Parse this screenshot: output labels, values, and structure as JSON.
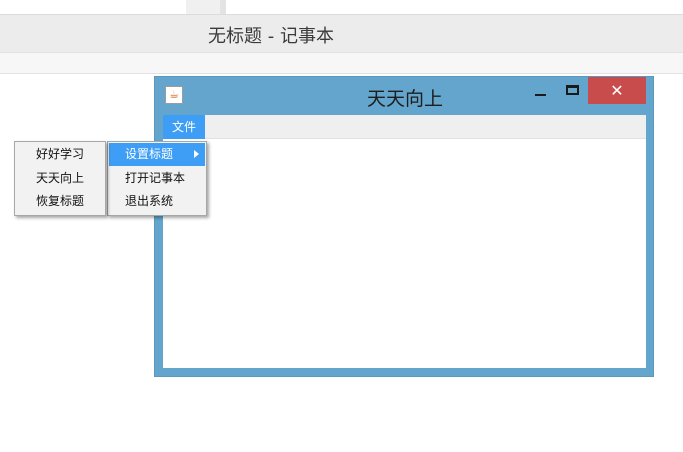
{
  "notepad": {
    "title": "无标题 - 记事本"
  },
  "frame": {
    "title": "天天向上",
    "close_glyph": "✕",
    "app_icon_glyph": "☕",
    "menu_file": "文件"
  },
  "file_menu": {
    "items": [
      {
        "label": "设置标题"
      },
      {
        "label": "打开记事本"
      },
      {
        "label": "退出系统"
      }
    ]
  },
  "title_submenu": {
    "items": [
      {
        "label": "好好学习"
      },
      {
        "label": "天天向上"
      },
      {
        "label": "恢复标题"
      }
    ]
  },
  "colors": {
    "frame_border": "#63a5cc",
    "close_button": "#c94c4c",
    "selection": "#3e9ef5"
  }
}
